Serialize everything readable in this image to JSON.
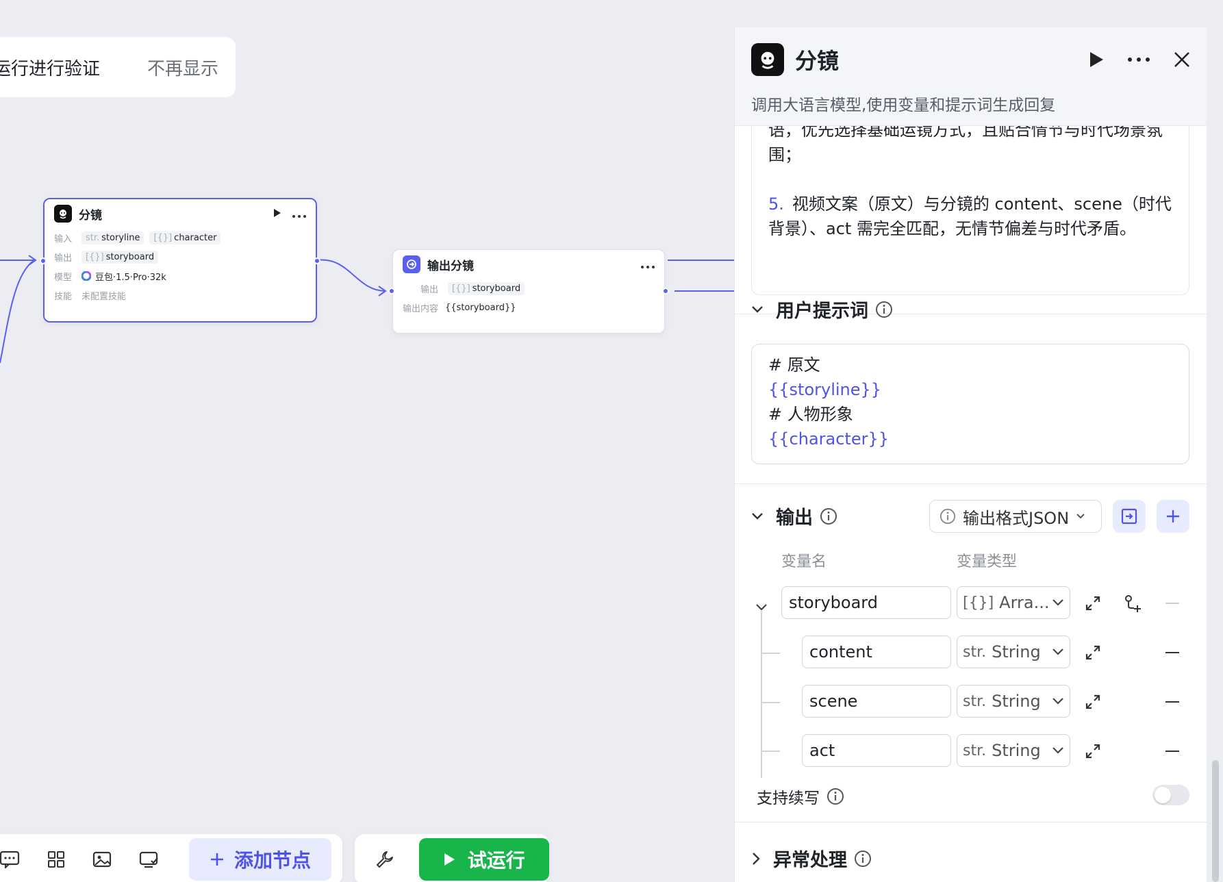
{
  "toast": {
    "message": "运行进行验证",
    "dismiss": "不再显示"
  },
  "node_llm": {
    "title": "分镜",
    "input_label": "输入",
    "inputs": [
      {
        "type": "str.",
        "name": "storyline"
      },
      {
        "type": "[{}]",
        "name": "character"
      }
    ],
    "output_label": "输出",
    "output": {
      "type": "[{}]",
      "name": "storyboard"
    },
    "model_label": "模型",
    "model": "豆包·1.5·Pro·32k",
    "skill_label": "技能",
    "skill": "未配置技能"
  },
  "node_output": {
    "title": "输出分镜",
    "output_label": "输出",
    "output": {
      "type": "[{}]",
      "name": "storyboard"
    },
    "content_label": "输出内容",
    "content": "{{storyboard}}"
  },
  "toolbar": {
    "add_node": "添加节点",
    "run": "试运行"
  },
  "panel": {
    "title": "分镜",
    "description": "调用大语言模型,使用变量和提示词生成回复",
    "system_prompt": {
      "clipped_line": "语，优先选择基础运镜方式，且贴合情节与时代场景氛",
      "line2": "围；",
      "item_number": "5.",
      "item_text_1": "视频文案（原文）与分镜的 content、scene（时代",
      "item_text_2": "背景）、act 需完全匹配，无情节偏差与时代矛盾。"
    },
    "user_prompt": {
      "title": "用户提示词",
      "lines": [
        "# 原文",
        "{{storyline}}",
        "# 人物形象",
        "{{character}}"
      ]
    },
    "output": {
      "title": "输出",
      "format_button": "输出格式JSON",
      "col_name": "变量名",
      "col_type": "变量类型",
      "rows": [
        {
          "name": "storyboard",
          "type_icon": "[{}]",
          "type": "Arra..."
        },
        {
          "name": "content",
          "type_icon": "str.",
          "type": "String"
        },
        {
          "name": "scene",
          "type_icon": "str.",
          "type": "String"
        },
        {
          "name": "act",
          "type_icon": "str.",
          "type": "String"
        }
      ]
    },
    "continue_write": "支持续写",
    "exception": "异常处理"
  },
  "colors": {
    "accent": "#4d53e8",
    "run_green": "#18b54a"
  }
}
